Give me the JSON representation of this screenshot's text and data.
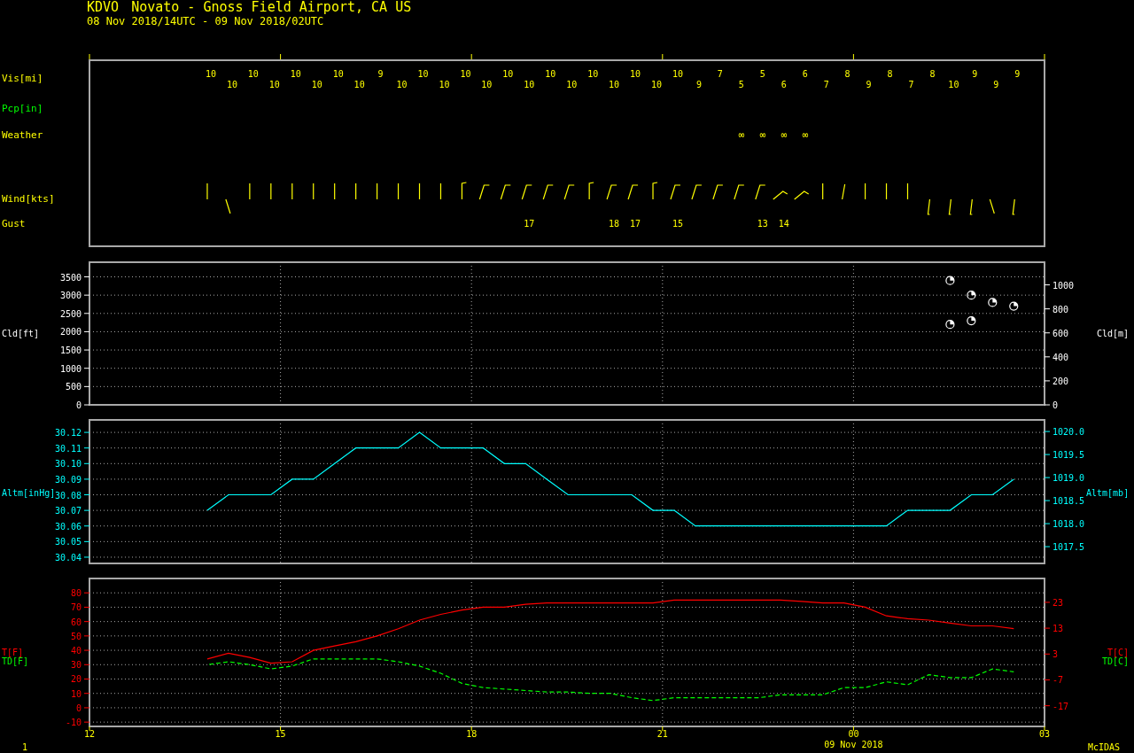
{
  "header": {
    "station": "KDVO",
    "name": "Novato - Gnoss Field Airport, CA US",
    "period": "08 Nov 2018/14UTC - 09 Nov 2018/02UTC"
  },
  "station_plot": {
    "rows": [
      {
        "kind": "vis",
        "label": "Vis[mi]",
        "color": "#ffff00"
      },
      {
        "kind": "pcp",
        "label": "Pcp[in]",
        "color": "#00ff00"
      },
      {
        "kind": "weather",
        "label": "Weather",
        "color": "#ffff00"
      },
      {
        "kind": "wind",
        "label": "Wind[kts]",
        "color": "#ffff00"
      },
      {
        "kind": "gust",
        "label": "Gust",
        "color": "#ffff00"
      }
    ],
    "observations": [
      {
        "vis": "10",
        "wind_barb": {
          "kind": "up"
        }
      },
      {
        "vis": "10",
        "wind_barb": {
          "kind": "back"
        }
      },
      {
        "vis": "10",
        "wind_barb": {
          "kind": "up"
        }
      },
      {
        "vis": "10",
        "wind_barb": {
          "kind": "up"
        }
      },
      {
        "vis": "10",
        "wind_barb": {
          "kind": "up"
        }
      },
      {
        "vis": "10",
        "wind_barb": {
          "kind": "up"
        }
      },
      {
        "vis": "10",
        "wind_barb": {
          "kind": "up"
        }
      },
      {
        "vis": "10",
        "wind_barb": {
          "kind": "up"
        }
      },
      {
        "vis": "9",
        "wind_barb": {
          "kind": "up"
        }
      },
      {
        "vis": "10",
        "wind_barb": {
          "kind": "up"
        }
      },
      {
        "vis": "10",
        "wind_barb": {
          "kind": "up"
        }
      },
      {
        "vis": "10",
        "wind_barb": {
          "kind": "up"
        }
      },
      {
        "vis": "10",
        "wind_barb": {
          "kind": "hook"
        }
      },
      {
        "vis": "10",
        "wind_barb": {
          "kind": "lean"
        }
      },
      {
        "vis": "10",
        "wind_barb": {
          "kind": "lean"
        }
      },
      {
        "vis": "10",
        "wind_barb": {
          "kind": "lean"
        },
        "gust": "17"
      },
      {
        "vis": "10",
        "wind_barb": {
          "kind": "lean"
        }
      },
      {
        "vis": "10",
        "wind_barb": {
          "kind": "lean"
        }
      },
      {
        "vis": "10",
        "wind_barb": {
          "kind": "hook"
        }
      },
      {
        "vis": "10",
        "wind_barb": {
          "kind": "lean"
        },
        "gust": "18"
      },
      {
        "vis": "10",
        "wind_barb": {
          "kind": "lean"
        },
        "gust": "17"
      },
      {
        "vis": "10",
        "wind_barb": {
          "kind": "hook"
        }
      },
      {
        "vis": "10",
        "wind_barb": {
          "kind": "lean"
        },
        "gust": "15"
      },
      {
        "vis": "9",
        "wind_barb": {
          "kind": "lean"
        }
      },
      {
        "vis": "7",
        "wind_barb": {
          "kind": "lean"
        }
      },
      {
        "vis": "5",
        "wind_barb": {
          "kind": "lean"
        },
        "weather": "∞"
      },
      {
        "vis": "5",
        "wind_barb": {
          "kind": "lean"
        },
        "weather": "∞",
        "gust": "13"
      },
      {
        "vis": "6",
        "wind_barb": {
          "kind": "shallow"
        },
        "weather": "∞",
        "gust": "14"
      },
      {
        "vis": "6",
        "wind_barb": {
          "kind": "shallow"
        },
        "weather": "∞"
      },
      {
        "vis": "7",
        "wind_barb": {
          "kind": "up"
        }
      },
      {
        "vis": "8",
        "wind_barb": {
          "kind": "tilt"
        }
      },
      {
        "vis": "9",
        "wind_barb": {
          "kind": "up"
        }
      },
      {
        "vis": "8",
        "wind_barb": {
          "kind": "up"
        }
      },
      {
        "vis": "7",
        "wind_barb": {
          "kind": "up"
        }
      },
      {
        "vis": "8",
        "wind_barb": {
          "kind": "down"
        }
      },
      {
        "vis": "10",
        "wind_barb": {
          "kind": "down"
        }
      },
      {
        "vis": "9",
        "wind_barb": {
          "kind": "down"
        }
      },
      {
        "vis": "9",
        "wind_barb": {
          "kind": "back"
        }
      },
      {
        "vis": "9",
        "wind_barb": {
          "kind": "down"
        }
      }
    ]
  },
  "cloud": {
    "right_axis": {
      "label": "Cld[m]",
      "kind": "metres",
      "ticks": [
        "1000",
        "800",
        "600",
        "400",
        "200",
        "0"
      ]
    },
    "chart_data": {
      "type": "scatter",
      "ylabel": "Cld[ft]",
      "x": [
        "2018-11-09T01:31",
        "2018-11-09T01:51",
        "2018-11-09T02:11",
        "2018-11-09T02:31",
        "2018-11-09T01:31",
        "2018-11-09T01:51"
      ],
      "series": [
        {
          "color": "#ffffff",
          "values": [
            3400,
            3000,
            2800,
            2700,
            2200,
            2300
          ]
        }
      ],
      "xlim": [
        "2018-11-08T12:00",
        "2018-11-09T03:00"
      ],
      "ylim": [
        0,
        3900
      ],
      "grid": true,
      "yticks": [
        0,
        500,
        1000,
        1500,
        2000,
        2500,
        3000,
        3500
      ]
    }
  },
  "altimeter": {
    "right_axis": {
      "label": "Altm[mb]",
      "kind": "millibars",
      "ticks": [
        "1020.0",
        "1019.5",
        "1019.0",
        "1018.5",
        "1018.0",
        "1017.5"
      ]
    },
    "chart_data": {
      "type": "line",
      "ylabel": "Altm[inHg]",
      "x": [
        "2018-11-08T13:51",
        "2018-11-08T14:11",
        "2018-11-08T14:31",
        "2018-11-08T14:51",
        "2018-11-08T15:11",
        "2018-11-08T15:31",
        "2018-11-08T15:51",
        "2018-11-08T16:11",
        "2018-11-08T16:31",
        "2018-11-08T16:51",
        "2018-11-08T17:11",
        "2018-11-08T17:31",
        "2018-11-08T17:51",
        "2018-11-08T18:11",
        "2018-11-08T18:31",
        "2018-11-08T18:51",
        "2018-11-08T19:11",
        "2018-11-08T19:31",
        "2018-11-08T19:51",
        "2018-11-08T20:11",
        "2018-11-08T20:31",
        "2018-11-08T20:51",
        "2018-11-08T21:11",
        "2018-11-08T21:31",
        "2018-11-08T21:51",
        "2018-11-08T22:11",
        "2018-11-08T22:31",
        "2018-11-08T22:51",
        "2018-11-08T23:11",
        "2018-11-08T23:31",
        "2018-11-08T23:51",
        "2018-11-09T00:11",
        "2018-11-09T00:31",
        "2018-11-09T00:51",
        "2018-11-09T01:11",
        "2018-11-09T01:31",
        "2018-11-09T01:51",
        "2018-11-09T02:11",
        "2018-11-09T02:31"
      ],
      "series": [
        {
          "color": "#00ffff",
          "values": [
            30.07,
            30.08,
            30.08,
            30.08,
            30.09,
            30.09,
            30.1,
            30.11,
            30.11,
            30.11,
            30.12,
            30.11,
            30.11,
            30.11,
            30.1,
            30.1,
            30.09,
            30.08,
            30.08,
            30.08,
            30.08,
            30.07,
            30.07,
            30.06,
            30.06,
            30.06,
            30.06,
            30.06,
            30.06,
            30.06,
            30.06,
            30.06,
            30.06,
            30.07,
            30.07,
            30.07,
            30.08,
            30.08,
            30.09
          ]
        }
      ],
      "xlim": [
        "2018-11-08T12:00",
        "2018-11-09T03:00"
      ],
      "ylim": [
        30.036,
        30.128
      ],
      "grid": true,
      "yticks": [
        {
          "value": 30.04,
          "label": "30.04"
        },
        {
          "value": 30.05,
          "label": "30.05"
        },
        {
          "value": 30.06,
          "label": "30.06"
        },
        {
          "value": 30.07,
          "label": "30.07"
        },
        {
          "value": 30.08,
          "label": "30.08"
        },
        {
          "value": 30.09,
          "label": "30.09"
        },
        {
          "value": 30.1,
          "label": "30.10"
        },
        {
          "value": 30.11,
          "label": "30.11"
        },
        {
          "value": 30.12,
          "label": "30.12"
        }
      ]
    }
  },
  "temperature": {
    "right_labels": [
      {
        "label": "T[C]",
        "color": "#ff0000"
      },
      {
        "label": "TD[C]",
        "color": "#00ff00"
      }
    ],
    "right_axis": {
      "kind": "celsius",
      "ticks": [
        "23",
        "13",
        "3",
        "-7",
        "-17"
      ]
    },
    "date_label": "09 Nov 2018",
    "chart_data": {
      "type": "line",
      "x": [
        "2018-11-08T13:51",
        "2018-11-08T14:11",
        "2018-11-08T14:31",
        "2018-11-08T14:51",
        "2018-11-08T15:11",
        "2018-11-08T15:31",
        "2018-11-08T15:51",
        "2018-11-08T16:11",
        "2018-11-08T16:31",
        "2018-11-08T16:51",
        "2018-11-08T17:11",
        "2018-11-08T17:31",
        "2018-11-08T17:51",
        "2018-11-08T18:11",
        "2018-11-08T18:31",
        "2018-11-08T18:51",
        "2018-11-08T19:11",
        "2018-11-08T19:31",
        "2018-11-08T19:51",
        "2018-11-08T20:11",
        "2018-11-08T20:31",
        "2018-11-08T20:51",
        "2018-11-08T21:11",
        "2018-11-08T21:31",
        "2018-11-08T21:51",
        "2018-11-08T22:11",
        "2018-11-08T22:31",
        "2018-11-08T22:51",
        "2018-11-08T23:11",
        "2018-11-08T23:31",
        "2018-11-08T23:51",
        "2018-11-09T00:11",
        "2018-11-09T00:31",
        "2018-11-09T00:51",
        "2018-11-09T01:11",
        "2018-11-09T01:31",
        "2018-11-09T01:51",
        "2018-11-09T02:11",
        "2018-11-09T02:31"
      ],
      "series": [
        {
          "name": "T[F]",
          "color": "#ff0000",
          "line_style": "solid",
          "values": [
            34,
            38,
            35,
            31,
            32,
            40,
            43,
            46,
            50,
            55,
            61,
            65,
            68,
            70,
            70,
            72,
            73,
            73,
            73,
            73,
            73,
            73,
            75,
            75,
            75,
            75,
            75,
            75,
            74,
            73,
            73,
            70,
            64,
            62,
            61,
            59,
            57,
            57,
            55
          ]
        },
        {
          "name": "TD[F]",
          "color": "#00ff00",
          "line_style": "dashed",
          "values": [
            30,
            32,
            30,
            27,
            29,
            34,
            34,
            34,
            34,
            32,
            29,
            24,
            17,
            14,
            13,
            12,
            11,
            11,
            10,
            10,
            7,
            5,
            7,
            7,
            7,
            7,
            7,
            9,
            9,
            9,
            14,
            14,
            18,
            16,
            23,
            21,
            21,
            27,
            25
          ]
        }
      ],
      "xlim": [
        "2018-11-08T12:00",
        "2018-11-09T03:00"
      ],
      "ylim": [
        -13,
        90
      ],
      "grid": true,
      "xticks": [
        {
          "value": "2018-11-08T12:00",
          "label": "12"
        },
        {
          "value": "2018-11-08T15:00",
          "label": "15"
        },
        {
          "value": "2018-11-08T18:00",
          "label": "18"
        },
        {
          "value": "2018-11-08T21:00",
          "label": "21"
        },
        {
          "value": "2018-11-09T00:00",
          "label": "00"
        },
        {
          "value": "2018-11-09T03:00",
          "label": "03"
        }
      ],
      "yticks": [
        -10,
        0,
        10,
        20,
        30,
        40,
        50,
        60,
        70,
        80
      ]
    }
  },
  "footer": {
    "page": "1",
    "software": "McIDAS"
  }
}
